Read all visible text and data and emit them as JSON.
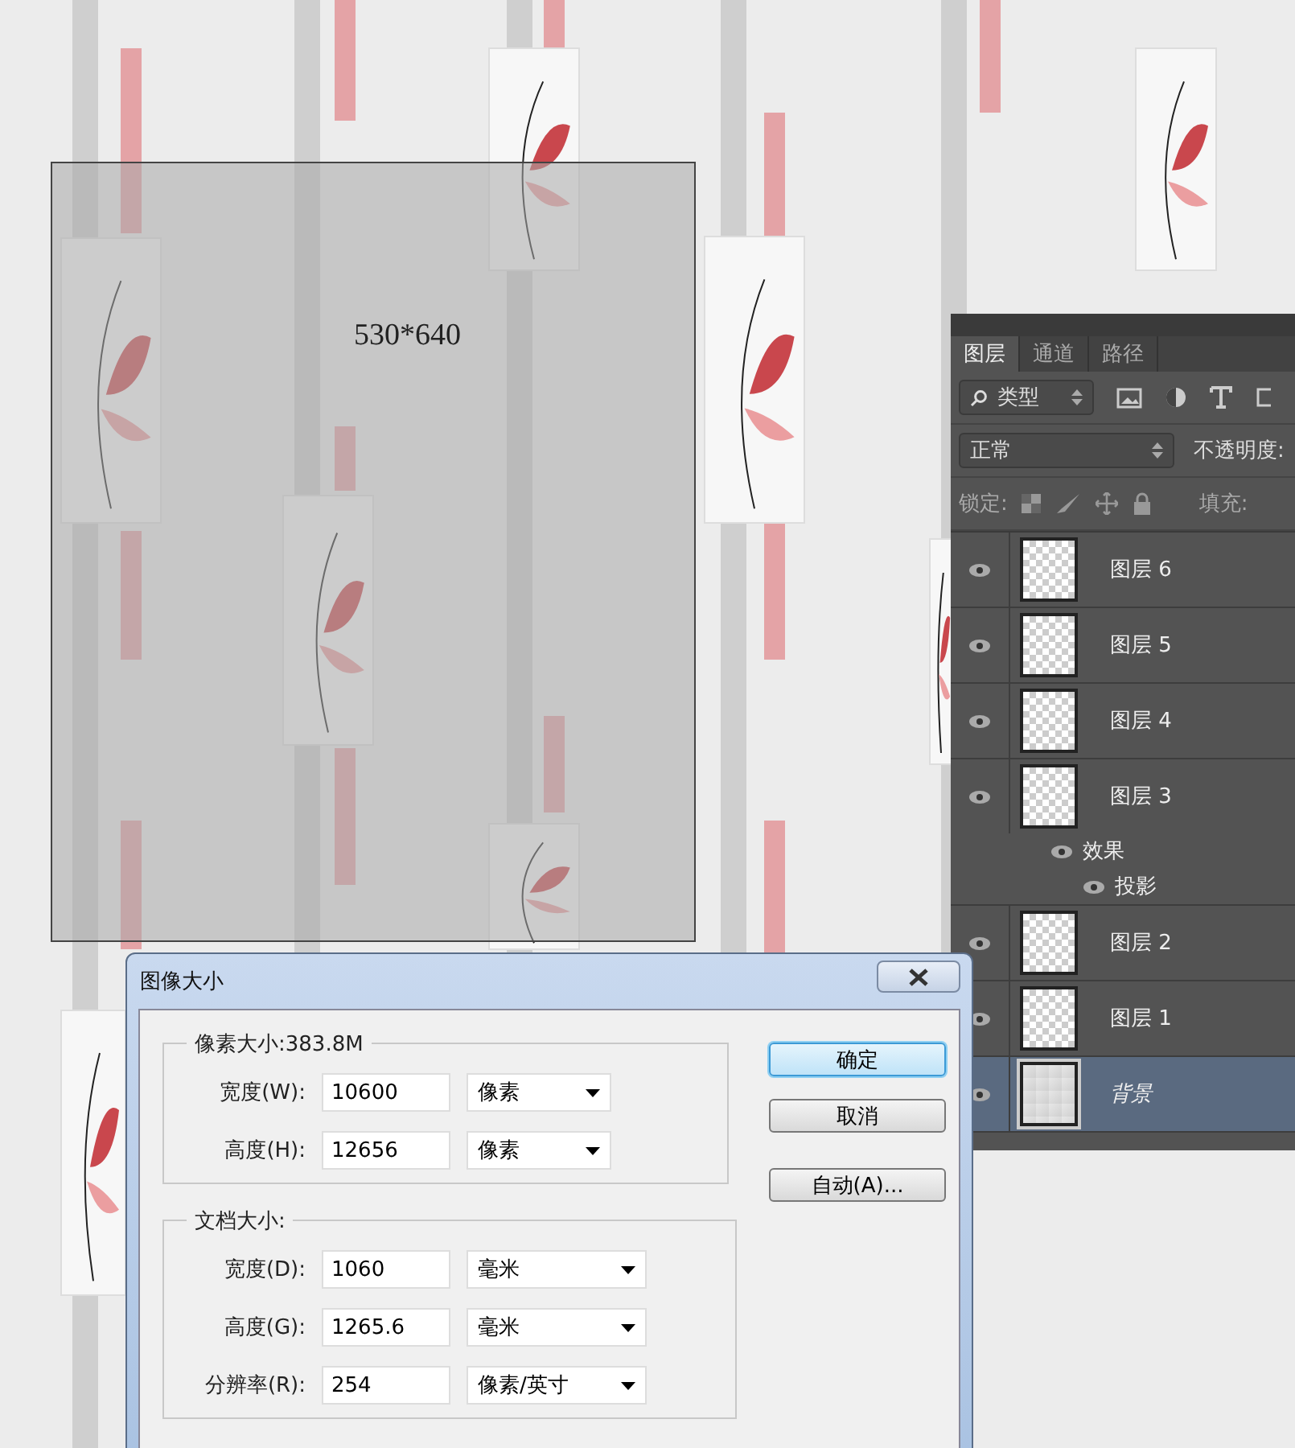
{
  "canvas": {
    "size_label": "530*640"
  },
  "layers_panel": {
    "tabs": [
      {
        "label": "图层",
        "selected": true
      },
      {
        "label": "通道",
        "selected": false
      },
      {
        "label": "路径",
        "selected": false
      }
    ],
    "filter": {
      "value": "类型"
    },
    "blend_mode": {
      "value": "正常"
    },
    "opacity_label": "不透明度:",
    "lock_label": "锁定:",
    "fill_label": "填充:",
    "layers": [
      {
        "name": "图层 6",
        "kind": "layer",
        "visible": true,
        "selected": false
      },
      {
        "name": "图层 5",
        "kind": "layer",
        "visible": true,
        "selected": false
      },
      {
        "name": "图层 4",
        "kind": "layer",
        "visible": true,
        "selected": false
      },
      {
        "name": "图层 3",
        "kind": "layer",
        "visible": true,
        "selected": false,
        "children": [
          {
            "name": "效果",
            "visible": true,
            "children": [
              {
                "name": "投影",
                "visible": true
              }
            ]
          }
        ]
      },
      {
        "name": "图层 2",
        "kind": "layer",
        "visible": true,
        "selected": false
      },
      {
        "name": "图层 1",
        "kind": "layer",
        "visible": true,
        "selected": false
      },
      {
        "name": "背景",
        "kind": "background",
        "visible": true,
        "selected": true
      }
    ]
  },
  "dialog": {
    "title": "图像大小",
    "pixel_size": {
      "legend": "像素大小:383.8M",
      "fields": [
        {
          "label": "宽度(W):",
          "value": "10600",
          "unit": "像素"
        },
        {
          "label": "高度(H):",
          "value": "12656",
          "unit": "像素"
        }
      ]
    },
    "document_size": {
      "legend": "文档大小:",
      "fields": [
        {
          "label": "宽度(D):",
          "value": "1060",
          "unit": "毫米"
        },
        {
          "label": "高度(G):",
          "value": "1265.6",
          "unit": "毫米"
        },
        {
          "label": "分辨率(R):",
          "value": "254",
          "unit": "像素/英寸"
        }
      ]
    },
    "buttons": [
      {
        "label": "确定",
        "default": true
      },
      {
        "label": "取消",
        "default": false
      },
      {
        "label": "自动(A)...",
        "default": false
      }
    ]
  }
}
